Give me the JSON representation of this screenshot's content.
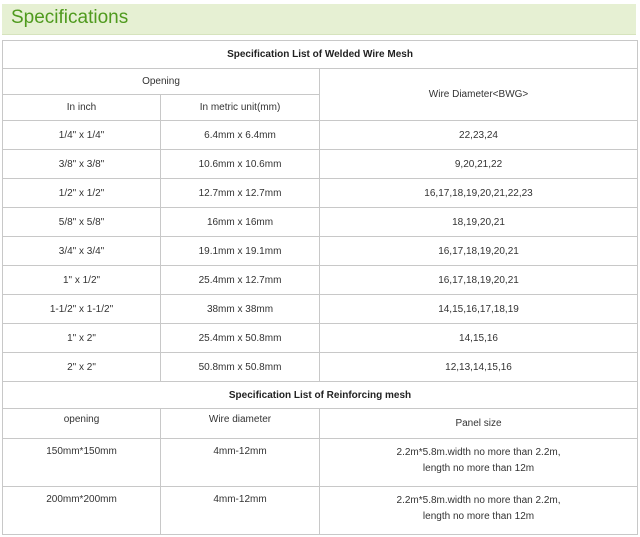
{
  "header": {
    "title": "Specifications"
  },
  "welded": {
    "title": "Specification List of Welded Wire Mesh",
    "opening_label": "Opening",
    "col_inch": "In inch",
    "col_metric": "In metric unit(mm)",
    "col_wire": "Wire Diameter<BWG>",
    "rows": [
      {
        "inch": "1/4\" x 1/4\"",
        "metric": "6.4mm x 6.4mm",
        "bwg": "22,23,24"
      },
      {
        "inch": "3/8\" x 3/8\"",
        "metric": "10.6mm x 10.6mm",
        "bwg": "9,20,21,22"
      },
      {
        "inch": "1/2\" x 1/2\"",
        "metric": "12.7mm x 12.7mm",
        "bwg": "16,17,18,19,20,21,22,23"
      },
      {
        "inch": "5/8\" x 5/8\"",
        "metric": "16mm x 16mm",
        "bwg": "18,19,20,21"
      },
      {
        "inch": "3/4\" x 3/4\"",
        "metric": "19.1mm x 19.1mm",
        "bwg": "16,17,18,19,20,21"
      },
      {
        "inch": "1\" x 1/2\"",
        "metric": "25.4mm x 12.7mm",
        "bwg": "16,17,18,19,20,21"
      },
      {
        "inch": "1-1/2\" x 1-1/2\"",
        "metric": "38mm x 38mm",
        "bwg": "14,15,16,17,18,19"
      },
      {
        "inch": "1\" x 2\"",
        "metric": "25.4mm x 50.8mm",
        "bwg": "14,15,16"
      },
      {
        "inch": "2\" x 2\"",
        "metric": "50.8mm x 50.8mm",
        "bwg": "12,13,14,15,16"
      }
    ]
  },
  "reinforcing": {
    "title": "Specification List of Reinforcing mesh",
    "col_opening": "opening",
    "col_wire": "Wire diameter",
    "col_panel": "Panel size",
    "rows": [
      {
        "opening": "150mm*150mm",
        "wire": "4mm-12mm",
        "panel_line1": "2.2m*5.8m.width no more than 2.2m,",
        "panel_line2": "length no more than 12m"
      },
      {
        "opening": "200mm*200mm",
        "wire": "4mm-12mm",
        "panel_line1": "2.2m*5.8m.width no more than 2.2m,",
        "panel_line2": "length no more than 12m"
      }
    ]
  }
}
